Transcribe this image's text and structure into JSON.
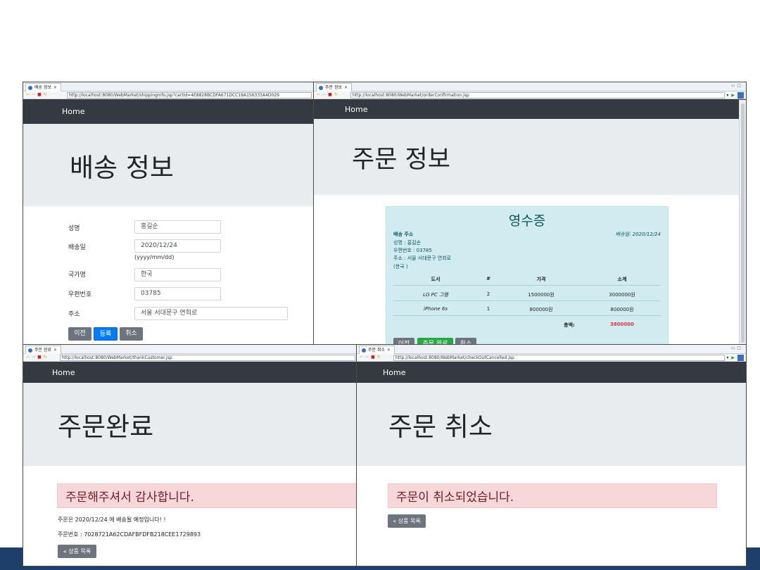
{
  "shipping": {
    "tab_title": "배송 정보",
    "url": "http://localhost:8080/WebMarket/shippingInfo.jsp?cartId=4E8828BCDFA671DCC19A156333A4D029",
    "nav_home": "Home",
    "heading": "배송 정보",
    "fields": {
      "name_label": "성명",
      "name_value": "홍길순",
      "date_label": "배송일",
      "date_value": "2020/12/24",
      "date_hint": "(yyyy/mm/dd)",
      "country_label": "국가명",
      "country_value": "한국",
      "zip_label": "우편번호",
      "zip_value": "03785",
      "address_label": "주소",
      "address_value": "서울 서대문구 연희로"
    },
    "buttons": {
      "prev": "이전",
      "register": "등록",
      "cancel": "취소"
    }
  },
  "order_info": {
    "tab_title": "주문 정보",
    "url": "http://localhost:8080/WebMarket/orderConfirmation.jsp",
    "nav_home": "Home",
    "heading": "주문 정보",
    "receipt": {
      "title": "영수증",
      "ship_addr_label": "배송 주소",
      "ship_date": "배송일: 2020/12/24",
      "name_line": "성명 : 홍길순",
      "zip_line": "우편번호 : 03785",
      "addr_line": "주소 : 서울 서대문구 연희로",
      "country_line": "(한국 )",
      "columns": [
        "도서",
        "#",
        "가격",
        "소계"
      ],
      "rows": [
        [
          "LG PC 그램",
          "2",
          "1500000원",
          "3000000원"
        ],
        [
          "iPhone 6s",
          "1",
          "800000원",
          "800000원"
        ]
      ],
      "total_label": "총액:",
      "total_value": "3800000",
      "buttons": {
        "prev": "이전",
        "complete": "주문 완료",
        "cancel": "취소"
      }
    }
  },
  "thanks": {
    "tab_title": "주문 완료",
    "url": "http://localhost:8080/WebMarket/thankCustomer.jsp",
    "nav_home": "Home",
    "heading": "주문완료",
    "alert": "주문해주셔서 감사합니다.",
    "ship_msg": "주문은 2020/12/24 에 배송될 예정입니다! !",
    "order_no": "주문번호 : 7028721A62CDAFBFDFB218CEE1729893",
    "back_button": "« 상품 목록"
  },
  "cancelled": {
    "tab_title": "주문 취소",
    "url": "http://localhost:8080/WebMarket/checkOutCancelled.jsp",
    "nav_home": "Home",
    "heading": "주문 취소",
    "alert": "주문이 취소되었습니다.",
    "back_button": "« 상품 목록"
  },
  "colors": {
    "navbar": "#343a40",
    "jumbotron": "#e9ecef",
    "primary": "#007bff",
    "success": "#28a745",
    "secondary": "#6c757d",
    "info_bg": "#d1ecf1",
    "danger_bg": "#f8d7da",
    "total_red": "#dc3545",
    "slide_bar": "#1f3f6b"
  }
}
